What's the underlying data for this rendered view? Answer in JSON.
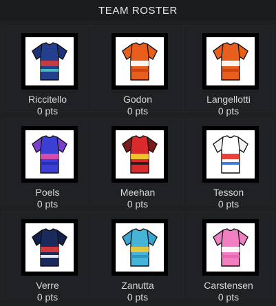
{
  "header": {
    "title": "TEAM ROSTER"
  },
  "riders": [
    {
      "name": "Riccitello",
      "points": "0 pts",
      "jersey": "decathlon-jersey-icon",
      "colors": {
        "body": "#233f8e",
        "accent": "#d23b3b",
        "stripe": "#46c8c8",
        "sleeve": "#1f3478"
      }
    },
    {
      "name": "Godon",
      "points": "0 pts",
      "jersey": "ineos-jersey-icon",
      "colors": {
        "body": "#e85e1c",
        "accent": "#ffffff",
        "stripe": "#c73f10",
        "sleeve": "#e85e1c"
      }
    },
    {
      "name": "Langellotti",
      "points": "0 pts",
      "jersey": "ineos-jersey-icon",
      "colors": {
        "body": "#e85e1c",
        "accent": "#ffffff",
        "stripe": "#c73f10",
        "sleeve": "#e85e1c"
      }
    },
    {
      "name": "Poels",
      "points": "0 pts",
      "jersey": "unibet-jersey-icon",
      "colors": {
        "body": "#3b3fd6",
        "accent": "#e04ea8",
        "stripe": "#2a2ab0",
        "sleeve": "#7a3fd0"
      }
    },
    {
      "name": "Meehan",
      "points": "0 pts",
      "jersey": "cofidis-jersey-icon",
      "colors": {
        "body": "#d92b2b",
        "accent": "#f2d02a",
        "stripe": "#1a1a1a",
        "sleeve": "#7a1b1b"
      }
    },
    {
      "name": "Tesson",
      "points": "0 pts",
      "jersey": "totalenergies-jersey-icon",
      "colors": {
        "body": "#ffffff",
        "accent": "#e8322a",
        "stripe": "#2d6bd6",
        "sleeve": "#f2f2f2"
      }
    },
    {
      "name": "Verre",
      "points": "0 pts",
      "jersey": "arkea-jersey-icon",
      "colors": {
        "body": "#1a2a5c",
        "accent": "#e33a3a",
        "stripe": "#ffffff",
        "sleeve": "#12204a"
      }
    },
    {
      "name": "Zanutta",
      "points": "0 pts",
      "jersey": "astana-jersey-icon",
      "colors": {
        "body": "#46b3d9",
        "accent": "#f0c83a",
        "stripe": "#2a8fbf",
        "sleeve": "#3aa6cf"
      }
    },
    {
      "name": "Carstensen",
      "points": "0 pts",
      "jersey": "ef-jersey-icon",
      "colors": {
        "body": "#ef7fc0",
        "accent": "#ffffff",
        "stripe": "#e766b3",
        "sleeve": "#ef7fc0"
      }
    }
  ]
}
